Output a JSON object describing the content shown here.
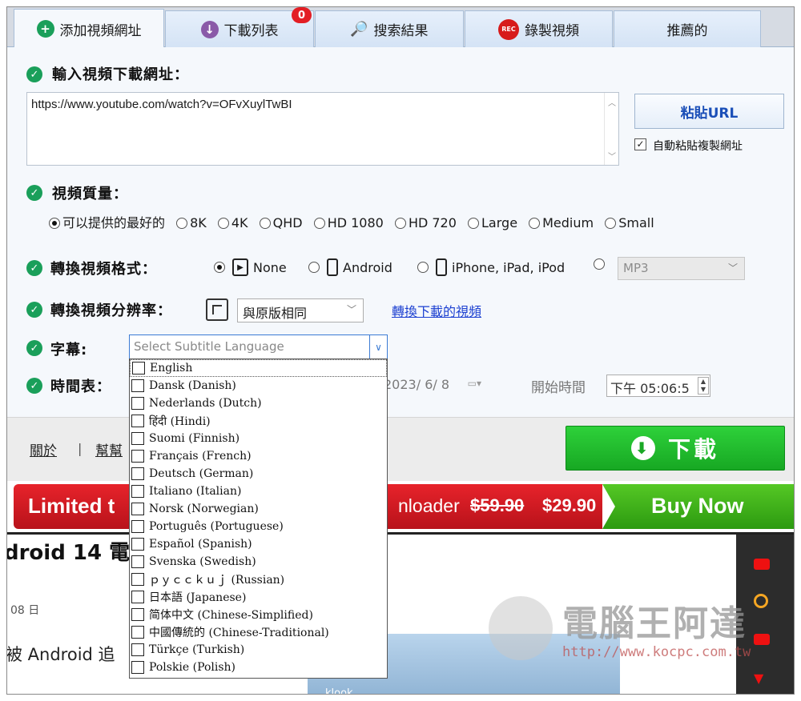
{
  "tabs": [
    {
      "label": "添加視頻網址",
      "icon": "plus-circle-icon",
      "color": "#1a9f5a"
    },
    {
      "label": "下載列表",
      "icon": "download-circle-icon",
      "color": "#8a5aa8"
    },
    {
      "label": "搜索結果",
      "icon": "magnifier-icon",
      "color": "#d9801a"
    },
    {
      "label": "錄製視頻",
      "icon": "rec-icon",
      "color": "#d71b1b",
      "icon_text": "REC"
    },
    {
      "label": "推薦的"
    }
  ],
  "download_badge": "0",
  "url_section": {
    "label": "輸入視頻下載網址：",
    "url_value": "https://www.youtube.com/watch?v=OFvXuylTwBI",
    "paste_button": "粘貼URL",
    "auto_paste_label": "自動粘貼複製網址",
    "auto_paste_checked": true
  },
  "quality": {
    "label": "視頻質量：",
    "options": [
      "可以提供的最好的",
      "8K",
      "4K",
      "QHD",
      "HD 1080",
      "HD 720",
      "Large",
      "Medium",
      "Small"
    ],
    "selected": "可以提供的最好的"
  },
  "format": {
    "label": "轉換視頻格式：",
    "options": [
      "None",
      "Android",
      "iPhone, iPad, iPod"
    ],
    "selected": "None",
    "audio_select": "MP3"
  },
  "resolution": {
    "label": "轉換視頻分辨率：",
    "value": "與原版相同",
    "convert_link": "轉換下載的視頻"
  },
  "subtitle": {
    "label": "字幕:",
    "placeholder": "Select Subtitle Language",
    "languages": [
      "English",
      "Dansk (Danish)",
      "Nederlands (Dutch)",
      "हिंदी (Hindi)",
      "Suomi (Finnish)",
      "Français (French)",
      "Deutsch (German)",
      "Italiano (Italian)",
      "Norsk (Norwegian)",
      "Português (Portuguese)",
      "Español (Spanish)",
      "Svenska (Swedish)",
      "ｐｙｃｃｋｕｊ (Russian)",
      "日本語 (Japanese)",
      "简体中文 (Chinese-Simplified)",
      "中國傳統的 (Chinese-Traditional)",
      "Türkçe (Turkish)",
      "Polskie (Polish)"
    ]
  },
  "schedule": {
    "label": "時間表：",
    "date_value": "2023/ 6/ 8",
    "start_time_label": "開始時間",
    "start_time_value": "下午 05:06:5"
  },
  "footer": {
    "about": "關於",
    "separator": "|",
    "help": "幫幫",
    "download_button": "下載"
  },
  "promo": {
    "left_text": "Limited t",
    "mid_text": "nloader",
    "old_price": "$59.90",
    "new_price": "$29.90",
    "buy_now": "Buy Now"
  },
  "background_page": {
    "headline": "droid 14 電",
    "date": "08 日",
    "snippet": "被 Android 追",
    "image_text": "klook"
  },
  "watermark": {
    "title": "電腦王阿達",
    "url": "http://www.kocpc.com.tw"
  },
  "colors": {
    "accent_green": "#1a9f5a",
    "download_green": "#17a823",
    "link_blue": "#1b3fd1",
    "promo_red": "#e7232b"
  }
}
